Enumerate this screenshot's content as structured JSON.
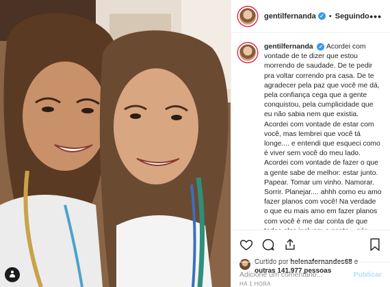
{
  "post": {
    "username": "gentilfernanda",
    "verified_mark": "✓",
    "separator": "•",
    "follow_status": "Seguindo",
    "more_glyph": "•••",
    "caption": "Acordei com vontade de te dizer que estou morrendo de saudade. De te pedir pra voltar correndo pra casa. De te agradecer pela paz que você me dá, pela confiança cega que a gente conquistou, pela cumplicidade que eu não sabia nem que existia. Acordei com vontade de estar com você, mas lembrei que você tá longe.... e entendi que esqueci como é viver sem você do meu lado. Acordei com vontade de fazer o que a gente sabe de melhor: estar junto. Papear. Tomar um vinho. Namorar. Sorrir. Planejar.... ahhh como eu amo fazer planos com você! Na verdade o que eu mais amo em fazer planos com você é me dar conta de que todos eles incluem a gente... nós"
  },
  "likes": {
    "prefix": "Curtido por",
    "first_user": "helenafernandes68",
    "connector": "e",
    "others": "outras 141.977 pessoas"
  },
  "time": "HÁ 1 HORA",
  "comment": {
    "placeholder": "Adicione um comentário...",
    "publish": "Publicar"
  },
  "icons": {
    "like": "heart-icon",
    "comment": "comment-bubble-icon",
    "share": "share-icon",
    "save": "bookmark-icon",
    "tag": "user-tag-icon"
  },
  "colors": {
    "verified": "#3897f0",
    "text": "#262626",
    "muted": "#8e8e8e",
    "publish_disabled": "#b2dffc"
  }
}
